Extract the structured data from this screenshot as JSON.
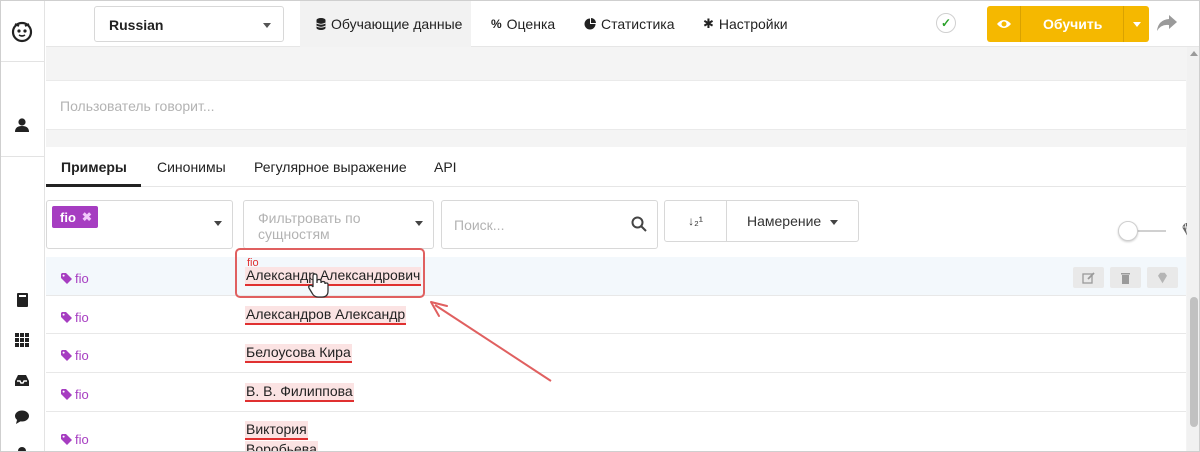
{
  "topbar": {
    "language": "Russian",
    "tabs": [
      {
        "label": "Обучающие данные",
        "icon": "database-icon"
      },
      {
        "label": "Оценка",
        "icon": "percent-icon"
      },
      {
        "label": "Статистика",
        "icon": "pie-chart-icon"
      },
      {
        "label": "Настройки",
        "icon": "gear-icon"
      }
    ],
    "train_button": "Обучить"
  },
  "user_input": {
    "placeholder": "Пользователь говорит..."
  },
  "subtabs": [
    "Примеры",
    "Синонимы",
    "Регулярное выражение",
    "API"
  ],
  "filters": {
    "entity_chip": "fio",
    "entity_filter_placeholder": "Фильтровать по сущностям",
    "search_placeholder": "Поиск...",
    "sort_icon_label": "↓₂¹",
    "intent_label": "Намерение"
  },
  "rows": [
    {
      "tag": "fio",
      "text": "Александр Александрович",
      "highlighted": true
    },
    {
      "tag": "fio",
      "text": "Александров Александр",
      "highlighted": false
    },
    {
      "tag": "fio",
      "text": "Белоусова Кира",
      "highlighted": false
    },
    {
      "tag": "fio",
      "text": "В. В. Филиппова",
      "highlighted": false
    },
    {
      "tag": "fio",
      "text_line1": "Виктория",
      "text_line2": "Воробьева",
      "highlighted": false
    }
  ],
  "callout": {
    "label": "fio"
  },
  "colors": {
    "accent": "#f5b800",
    "tag": "#a63dc1",
    "entity_underline": "#e03030",
    "callout_border": "#e06060"
  }
}
